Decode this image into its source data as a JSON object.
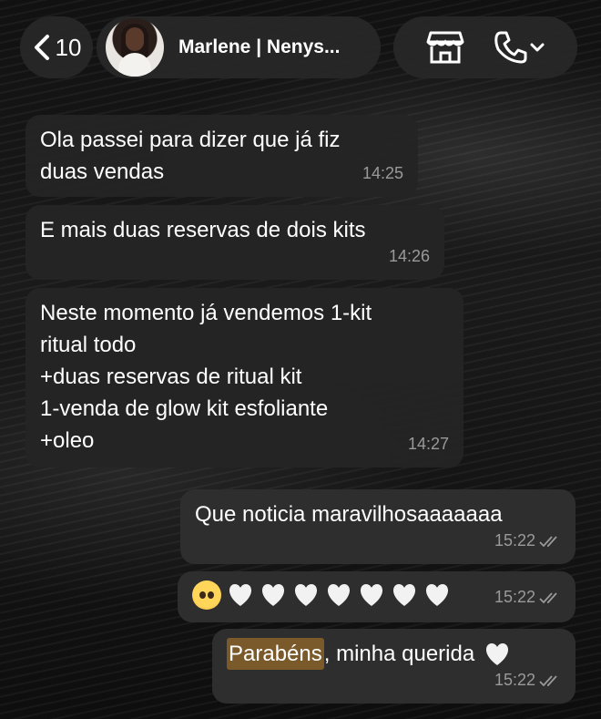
{
  "header": {
    "back_count": "10",
    "contact_name": "Marlene | Nenys..."
  },
  "messages": [
    {
      "direction": "in",
      "text": "Ola passei para dizer que já fiz\nduas vendas",
      "time": "14:25"
    },
    {
      "direction": "in",
      "text": "E mais duas reservas de dois kits",
      "time": "14:26"
    },
    {
      "direction": "in",
      "text": "Neste momento já vendemos 1-kit\nritual todo\n+duas reservas de ritual kit\n1-venda de glow kit esfoliante\n+oleo",
      "time": "14:27"
    },
    {
      "direction": "out",
      "text": "Que noticia maravilhosaaaaaaa",
      "time": "15:22",
      "status": "read"
    },
    {
      "direction": "out",
      "emojis": [
        "pleading-face",
        "white-heart",
        "white-heart",
        "white-heart",
        "white-heart",
        "white-heart",
        "white-heart",
        "white-heart"
      ],
      "time": "15:22",
      "status": "read"
    },
    {
      "direction": "out",
      "highlighted_word": "Parabéns",
      "text_after": ", minha querida",
      "emoji": "white-heart",
      "time": "15:22",
      "status": "read"
    }
  ],
  "colors": {
    "bubble_in": "#242424",
    "bubble_out": "#2e2e2e",
    "time_text": "#9a9a9a",
    "highlight": "#7a5a2a"
  }
}
